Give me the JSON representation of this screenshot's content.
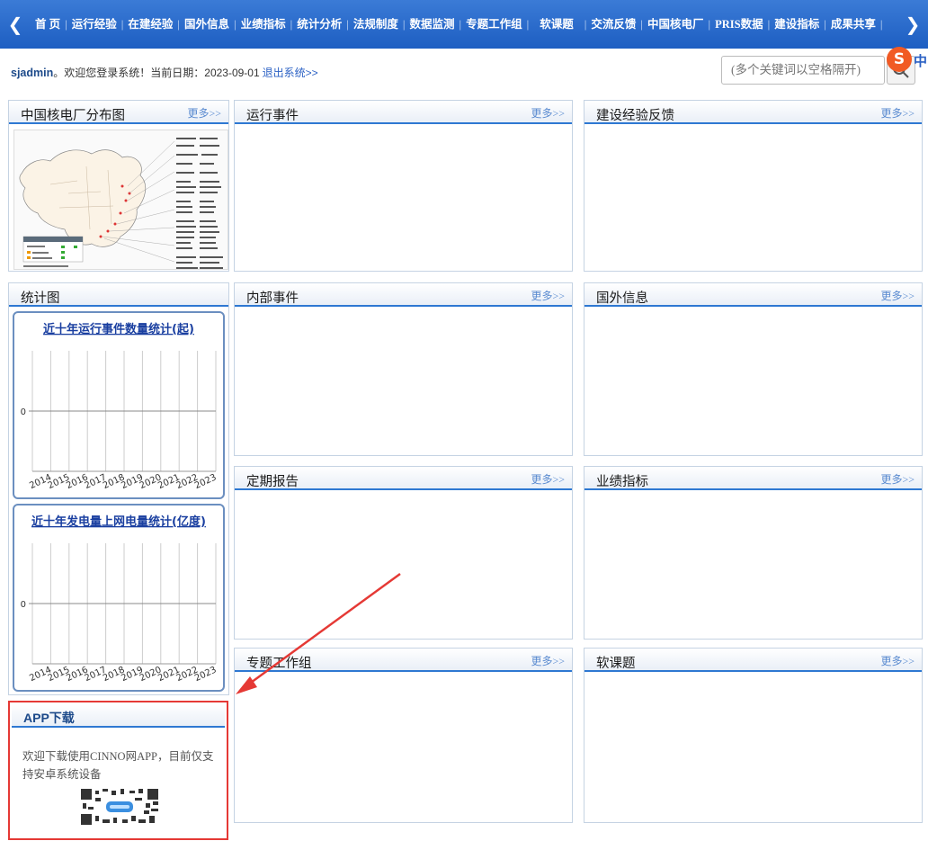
{
  "nav": {
    "left_arrow": "❮",
    "right_arrow": "❯",
    "items": [
      "首 页",
      "运行经验",
      "在建经验",
      "国外信息",
      "业绩指标",
      "统计分析",
      "法规制度",
      "数据监测",
      "专题工作组",
      "软课题",
      "交流反馈",
      "中国核电厂",
      "PRIS数据",
      "建设指标",
      "成果共享"
    ]
  },
  "user": {
    "name": "sjadmin",
    "welcome": "。欢迎您登录系统！当前日期：",
    "date": "2023-09-01",
    "logout": "退出系统",
    "logout_suffix": ">>"
  },
  "search": {
    "placeholder": "(多个关键词以空格隔开)",
    "icon": "search-icon"
  },
  "ime": {
    "logo": "S",
    "text": "中"
  },
  "more": "更多>>",
  "panels": {
    "map": {
      "title": "中国核电厂分布图"
    },
    "ops_events": {
      "title": "运行事件"
    },
    "construction": {
      "title": "建设经验反馈"
    },
    "stats": {
      "title": "统计图"
    },
    "internal_events": {
      "title": "内部事件"
    },
    "foreign_info": {
      "title": "国外信息"
    },
    "periodic": {
      "title": "定期报告"
    },
    "performance": {
      "title": "业绩指标"
    },
    "special": {
      "title": "专题工作组"
    },
    "soft": {
      "title": "软课题"
    }
  },
  "chart_data": [
    {
      "type": "bar",
      "title": "近十年运行事件数量统计(起)",
      "categories": [
        "2014",
        "2015",
        "2016",
        "2017",
        "2018",
        "2019",
        "2020",
        "2021",
        "2022",
        "2023"
      ],
      "values": [],
      "yticks": [
        "0"
      ]
    },
    {
      "type": "bar",
      "title": "近十年发电量上网电量统计(亿度)",
      "categories": [
        "2014",
        "2015",
        "2016",
        "2017",
        "2018",
        "2019",
        "2020",
        "2021",
        "2022",
        "2023"
      ],
      "values": [],
      "yticks": [
        "0"
      ]
    }
  ],
  "app": {
    "title": "APP下载",
    "description": "欢迎下载使用CINNO网APP，目前仅支持安卓系统设备"
  },
  "colors": {
    "nav": "#1d5ec2",
    "accent": "#2e78d2",
    "highlight": "#e53935"
  }
}
